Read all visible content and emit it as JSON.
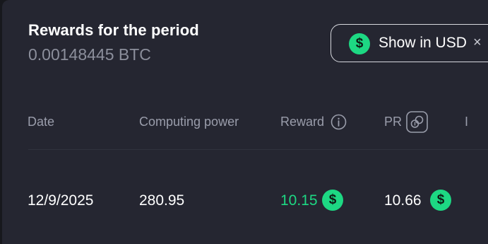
{
  "header": {
    "title": "Rewards for the period",
    "total": "0.00148445 BTC"
  },
  "usd_toggle": {
    "label": "Show in USD",
    "close": "×",
    "icon": "dollar-icon"
  },
  "table": {
    "columns": [
      "Date",
      "Computing power",
      "Reward",
      "PR",
      "I"
    ],
    "rows": [
      {
        "date": "12/9/2025",
        "computing_power": "280.95",
        "reward": "10.15",
        "pr": "10.66"
      }
    ]
  },
  "colors": {
    "accent": "#1dd883",
    "background": "#252631",
    "muted_text": "#9a9dab"
  }
}
